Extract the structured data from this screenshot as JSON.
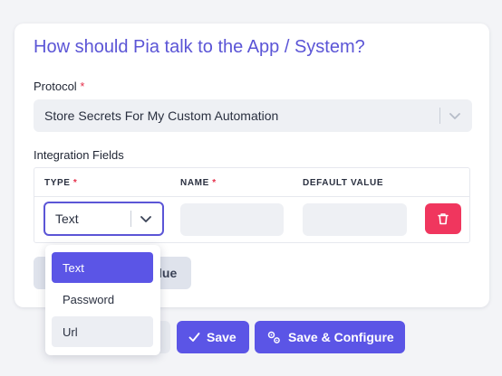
{
  "card": {
    "title": "How should Pia talk to the App / System?",
    "protocol_label": "Protocol",
    "protocol_required": "*",
    "protocol_value": "Store Secrets For My Custom Automation",
    "integration_fields_label": "Integration Fields"
  },
  "table": {
    "headers": [
      {
        "label": "TYPE",
        "required": "*"
      },
      {
        "label": "NAME",
        "required": "*"
      },
      {
        "label": "DEFAULT VALUE",
        "required": ""
      }
    ],
    "row": {
      "type_value": "Text",
      "name_value": "",
      "default_value": ""
    }
  },
  "hidden_button_label_fragment": "lue",
  "type_dropdown": {
    "options": [
      "Text",
      "Password",
      "Url"
    ],
    "selected": "Text",
    "hovered": "Url"
  },
  "footer": {
    "save_label": "Save",
    "save_configure_label": "Save & Configure"
  },
  "colors": {
    "accent": "#5b55e6",
    "title": "#5b55d6",
    "danger": "#f0365e",
    "required": "#e5304b"
  }
}
